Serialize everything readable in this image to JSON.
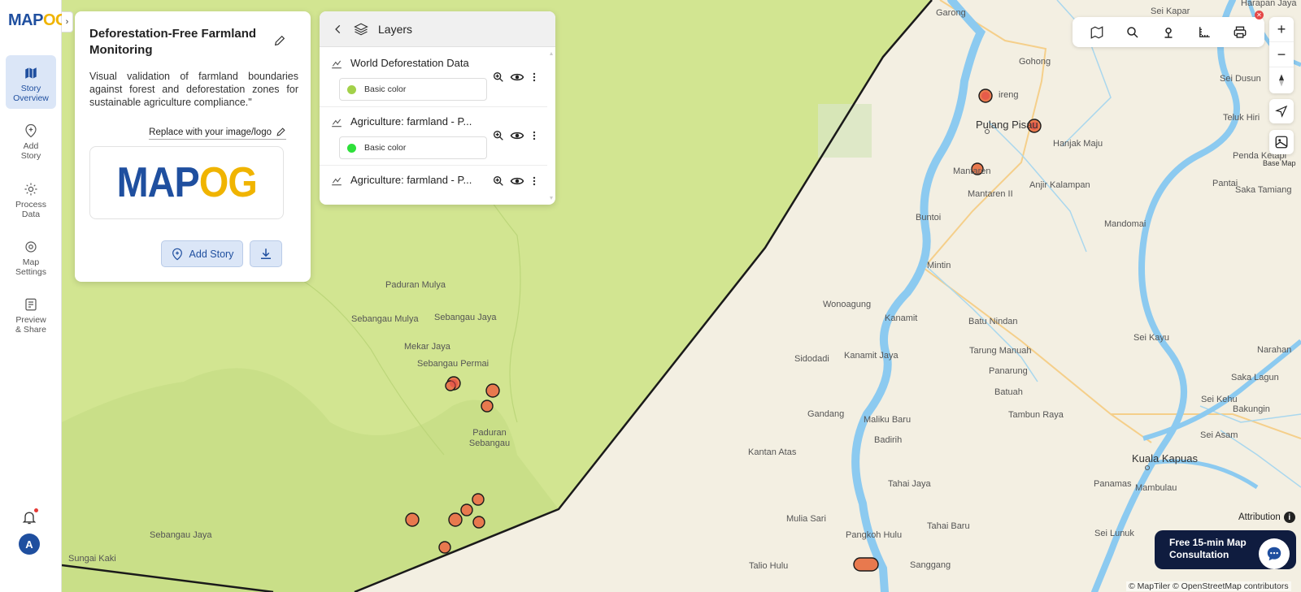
{
  "brand": {
    "logo_main": "MAP",
    "logo_accent": "OG"
  },
  "sidebar": {
    "items": [
      {
        "label_line1": "Story",
        "label_line2": "Overview",
        "icon": "map-icon"
      },
      {
        "label_line1": "Add",
        "label_line2": "Story",
        "icon": "add-pin-icon"
      },
      {
        "label_line1": "Process",
        "label_line2": "Data",
        "icon": "gear-icon"
      },
      {
        "label_line1": "Map",
        "label_line2": "Settings",
        "icon": "settings-icon"
      },
      {
        "label_line1": "Preview",
        "label_line2": "& Share",
        "icon": "preview-icon"
      }
    ],
    "avatar_initial": "A"
  },
  "story": {
    "title": "Deforestation-Free Farmland Monitoring",
    "description": "Visual validation of farmland boundaries against forest and deforestation zones for sustainable agriculture compliance.\"",
    "replace_label": "Replace with your image/logo",
    "add_story_label": "Add Story"
  },
  "layers": {
    "title": "Layers",
    "items": [
      {
        "name": "World Deforestation Data",
        "color_label": "Basic color",
        "color": "#a3d14a"
      },
      {
        "name": "Agriculture: farmland - P...",
        "color_label": "Basic color",
        "color": "#2ee03a"
      },
      {
        "name": "Agriculture: farmland - P..."
      }
    ]
  },
  "map": {
    "base_map_label": "Base Map",
    "attribution_label": "Attribution",
    "credit": "© MapTiler © OpenStreetMap contributors",
    "places": [
      "Garong",
      "Sei Kapar",
      "Harapan Jaya",
      "Gohong",
      "Sei Dusun",
      "Pulang Pisau",
      "Hanjak Maju",
      "Teluk Hiri",
      "Mantaren",
      "Mantaren II",
      "Anjir Kalampan",
      "Penda Ketapi",
      "Pantai",
      "Saka Tamiang",
      "Buntoi",
      "Mandomai",
      "Mintin",
      "Wonoagung",
      "Kanamit",
      "Batu Nindan",
      "Sei Kayu",
      "Sidodadi",
      "Kanamit Jaya",
      "Tarung Manuah",
      "Narahan",
      "Panarung",
      "Batuah",
      "Saka Lagun",
      "Sei Kehu",
      "Gandang",
      "Maliku Baru",
      "Tambun Raya",
      "Bakungin",
      "Badirih",
      "Sei Asam",
      "Kantan Atas",
      "Kuala Kapuas",
      "Tahai Jaya",
      "Panamas",
      "Mambulau",
      "Mulia Sari",
      "Tahai Baru",
      "Pangkoh Hulu",
      "Sei Lunuk",
      "Talio Hulu",
      "Sanggang",
      "Paduran Mulya",
      "Sebangau Mulya",
      "Sebangau Jaya",
      "Mekar Jaya",
      "Sebangau Permai",
      "Paduran Sebangau",
      "Sungai Kaki",
      "ireng"
    ]
  },
  "consult": {
    "line1": "Free 15-min Map",
    "line2": "Consultation"
  },
  "colors": {
    "brand_blue": "#1f4f9f",
    "brand_yellow": "#f0b400",
    "forest_green": "#d2e591",
    "land": "#f3efe2",
    "water": "#8ccaf0",
    "farmland_fill": "#e8794e"
  }
}
